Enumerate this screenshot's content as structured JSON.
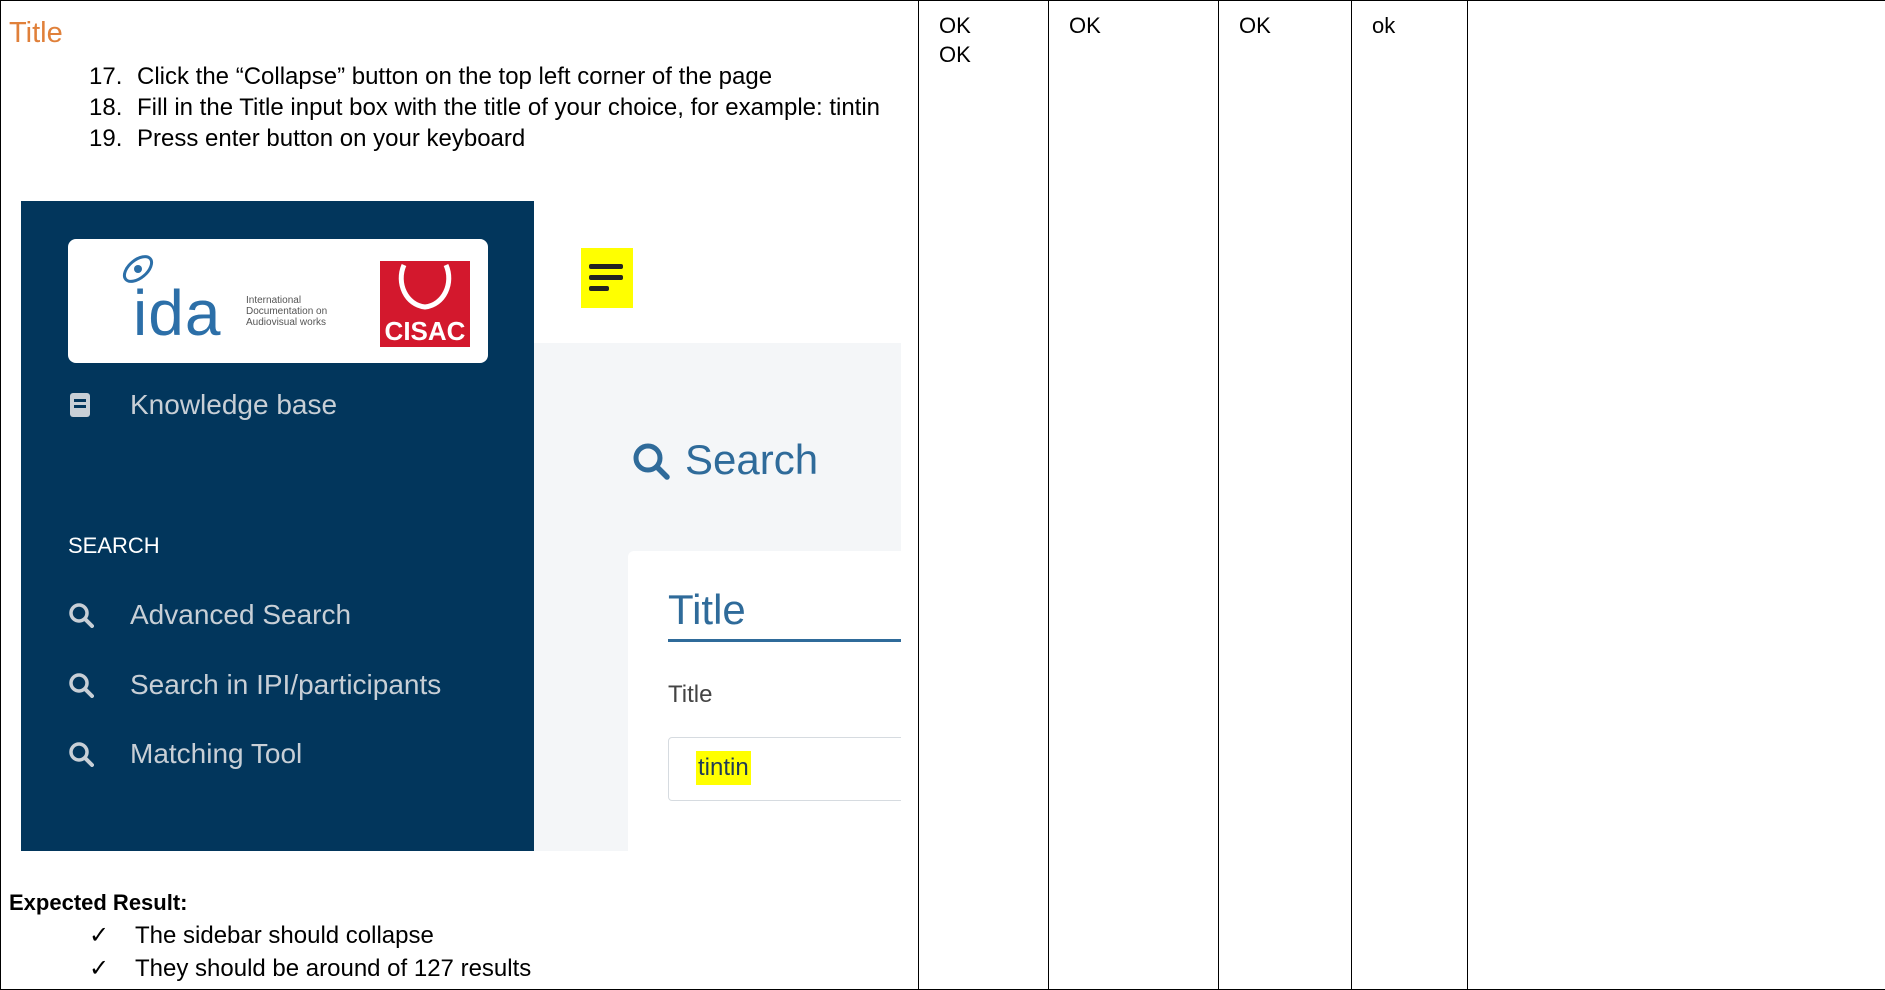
{
  "section_title": "Title",
  "steps": [
    {
      "number": "17.",
      "text": "Click the “Collapse” button on the top left corner of the page"
    },
    {
      "number": "18.",
      "text": "Fill in the Title input box with the title of your choice, for example: tintin"
    },
    {
      "number": "19.",
      "text": "Press enter button on your keyboard"
    }
  ],
  "screenshot": {
    "logo": {
      "ida_text": "ida",
      "ida_subtitle": "International Documentation on Audiovisual works",
      "cisac_text": "CISAC"
    },
    "sidebar": {
      "knowledge_base": "Knowledge base",
      "section_heading": "SEARCH",
      "items": [
        "Advanced Search",
        "Search in IPI/participants",
        "Matching Tool"
      ]
    },
    "page_heading": "Search",
    "card": {
      "title": "Title",
      "field_label": "Title",
      "field_value": "tintin"
    },
    "highlight_color": "#ffff00",
    "sidebar_color": "#02365c",
    "accent_color": "#2f6b9a"
  },
  "expected": {
    "label": "Expected Result:",
    "check_glyph": "✓",
    "items": [
      "The sidebar should collapse",
      "They should be around of 127 results"
    ]
  },
  "status_columns": [
    [
      "OK",
      "OK"
    ],
    [
      "OK"
    ],
    [
      "OK"
    ],
    [
      "ok"
    ],
    []
  ]
}
